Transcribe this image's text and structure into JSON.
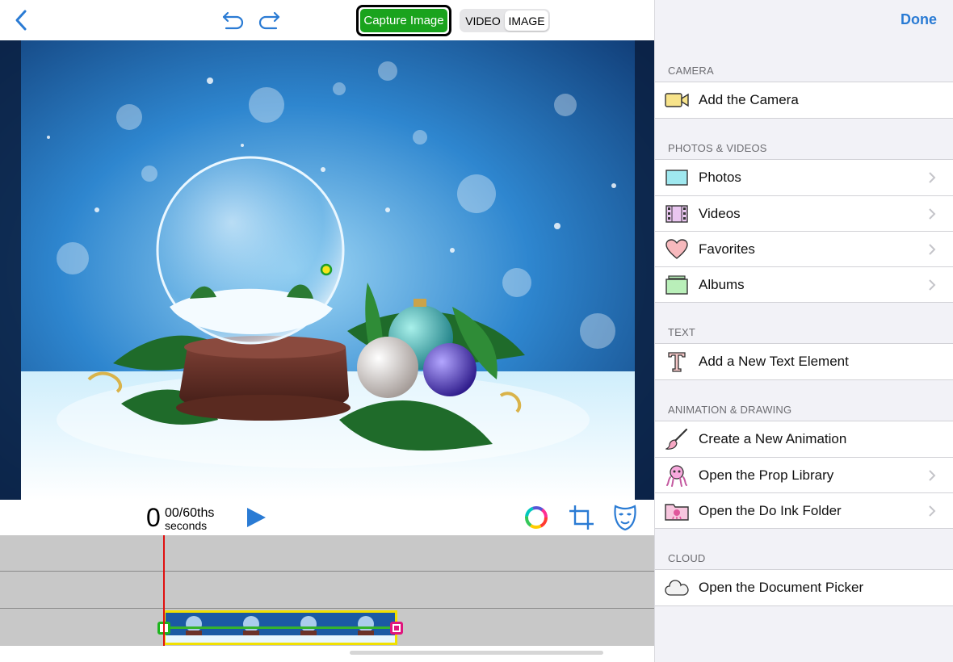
{
  "toolbar": {
    "capture_label": "Capture Image",
    "mode_video": "VIDEO",
    "mode_image": "IMAGE",
    "active_mode": "IMAGE"
  },
  "playback": {
    "time_whole": "0",
    "time_fraction": "00/60ths",
    "time_unit": "seconds"
  },
  "panel": {
    "done_label": "Done",
    "sections": [
      {
        "title": "CAMERA",
        "items": [
          {
            "label": "Add the Camera",
            "icon": "camera-icon",
            "chevron": false
          }
        ]
      },
      {
        "title": "PHOTOS & VIDEOS",
        "items": [
          {
            "label": "Photos",
            "icon": "photos-icon",
            "chevron": true
          },
          {
            "label": "Videos",
            "icon": "film-icon",
            "chevron": true
          },
          {
            "label": "Favorites",
            "icon": "heart-icon",
            "chevron": true
          },
          {
            "label": "Albums",
            "icon": "albums-icon",
            "chevron": true
          }
        ]
      },
      {
        "title": "TEXT",
        "items": [
          {
            "label": "Add a New Text Element",
            "icon": "text-t-icon",
            "chevron": false
          }
        ]
      },
      {
        "title": "ANIMATION & DRAWING",
        "items": [
          {
            "label": "Create a New Animation",
            "icon": "brush-icon",
            "chevron": false
          },
          {
            "label": "Open the Prop Library",
            "icon": "octopus-icon",
            "chevron": true
          },
          {
            "label": "Open the Do Ink Folder",
            "icon": "folder-icon",
            "chevron": true
          }
        ]
      },
      {
        "title": "CLOUD",
        "items": [
          {
            "label": "Open the Document Picker",
            "icon": "cloud-icon",
            "chevron": false
          }
        ]
      }
    ]
  },
  "colors": {
    "accent": "#2a7bd4",
    "capture_green": "#1aa31d",
    "playhead_red": "#e01010",
    "clip_border": "#f1e000"
  }
}
